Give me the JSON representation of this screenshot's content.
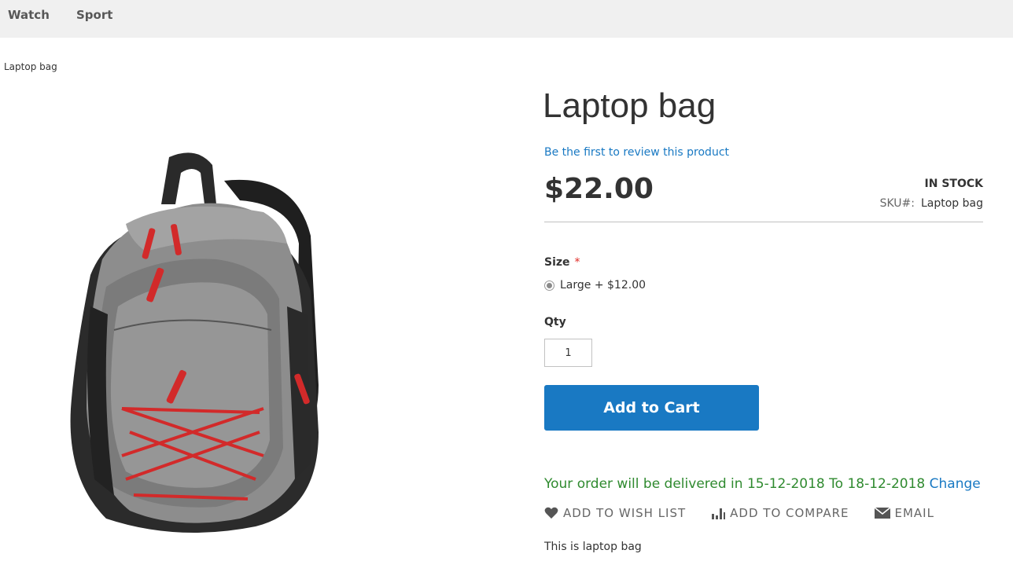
{
  "nav": {
    "items": [
      {
        "label": "Watch"
      },
      {
        "label": "Sport"
      }
    ]
  },
  "breadcrumb": {
    "current": "Laptop bag"
  },
  "product": {
    "title": "Laptop bag",
    "review_link": "Be the first to review this product",
    "price": "$22.00",
    "stock": "In stock",
    "sku_label": "SKU#:",
    "sku_value": "Laptop bag",
    "size_label": "Size",
    "required_mark": "*",
    "size_option": "Large + $12.00",
    "qty_label": "Qty",
    "qty_value": "1",
    "add_to_cart": "Add to Cart",
    "delivery_text": "Your order will be delivered in 15-12-2018 To 18-12-2018",
    "delivery_change": "Change",
    "description": "This is laptop bag"
  },
  "actions": {
    "wishlist": {
      "label": "Add to Wish List",
      "icon": "heart-icon"
    },
    "compare": {
      "label": "Add to Compare",
      "icon": "bar-chart-icon"
    },
    "email": {
      "label": "Email",
      "icon": "envelope-icon"
    }
  },
  "colors": {
    "accent": "#1979c3",
    "delivery_green": "#2f8a2f",
    "required_red": "#e02b27",
    "nav_bg": "#f0f0f0"
  },
  "image": {
    "subject": "backpack-image"
  }
}
